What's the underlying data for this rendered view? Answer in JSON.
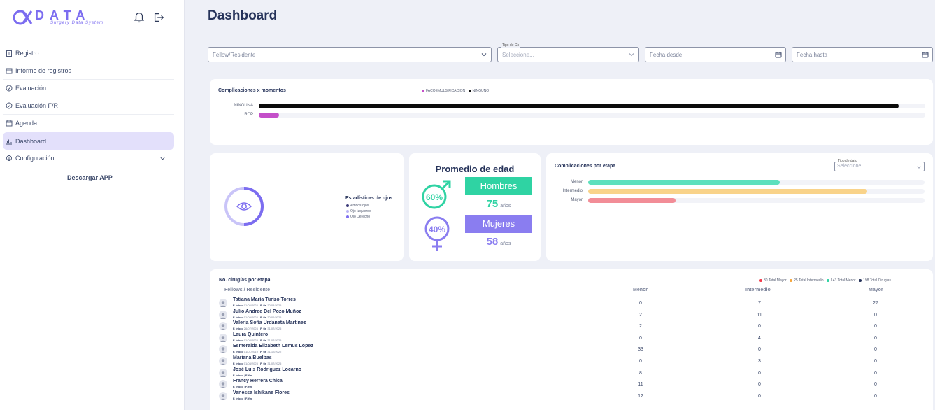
{
  "app": {
    "logo_title": "DATA",
    "logo_subtitle": "Surgery Data System",
    "brand_color": "#7c6df0"
  },
  "sidebar": {
    "items": [
      {
        "label": "Registro",
        "icon": "clipboard-icon"
      },
      {
        "label": "Informe de registros",
        "icon": "calendar-icon"
      },
      {
        "label": "Evaluación",
        "icon": "check-circle-icon"
      },
      {
        "label": "Evaluación F/R",
        "icon": "check-circle-icon"
      },
      {
        "label": "Agenda",
        "icon": "calendar-icon"
      },
      {
        "label": "Dashboard",
        "icon": "bar-chart-icon",
        "active": true
      },
      {
        "label": "Configuración",
        "icon": "gear-icon"
      }
    ],
    "download_label": "Descargar APP"
  },
  "page": {
    "title": "Dashboard"
  },
  "filters": {
    "fellow": "Fellow/Residente",
    "tipo_cx_label": "Tipo de Cx",
    "tipo_cx_placeholder": "Seleccione...",
    "fecha_desde": "Fecha desde",
    "fecha_hasta": "Fecha hasta"
  },
  "complicaciones_momentos": {
    "title": "Complicaciones x momentos",
    "legend": [
      {
        "name": "FACOEMULSIFICACION",
        "color": "#c44fc9"
      },
      {
        "name": "NINGUNO",
        "color": "#111111"
      }
    ],
    "categories": [
      "NINGUNA",
      "RCP"
    ],
    "values": [
      0.96,
      0.03
    ],
    "colors": [
      "#0b0b0b",
      "#c44fc9"
    ]
  },
  "ojos": {
    "title": "Estadísticas de ojos",
    "legend": [
      {
        "name": "Ambos ojos",
        "color": "#3d3c7a"
      },
      {
        "name": "Ojo Izquierdo",
        "color": "#b9b4f5"
      },
      {
        "name": "Ojo Derecho",
        "color": "#7c6df0"
      }
    ]
  },
  "edad": {
    "title": "Promedio de edad",
    "hombres": {
      "label": "Hombres",
      "pct": "60%",
      "age": "75",
      "unit": "años",
      "color": "#2fd3a3"
    },
    "mujeres": {
      "label": "Mujeres",
      "pct": "40%",
      "age": "58",
      "unit": "años",
      "color": "#8a7df0"
    }
  },
  "complicaciones_etapa": {
    "title": "Complicaciones por etapa",
    "select_label": "Tipo de dato",
    "select_placeholder": "Seleccione...",
    "categories": [
      "Menor",
      "Intermedio",
      "Mayor"
    ],
    "values": [
      0.57,
      0.83,
      0.26
    ],
    "colors": [
      "#5ee0bd",
      "#f9d38a",
      "#f28d97"
    ]
  },
  "cirugias": {
    "title": "No. cirugías por etapa",
    "legend": [
      {
        "text": "30 Total Mayor",
        "color": "#f23a4a"
      },
      {
        "text": "25 Total Intermedio",
        "color": "#f5a63c"
      },
      {
        "text": "143 Total Menor",
        "color": "#2fd3a3"
      },
      {
        "text": "198 Total Cirugias",
        "color": "#26335a"
      }
    ],
    "headers": {
      "fellows": "Fellows / Residente",
      "menor": "Menor",
      "intermedio": "Intermedio",
      "mayor": "Mayor"
    },
    "rows": [
      {
        "name": "Tatiana María Turizo Torres",
        "inicio": "01/05/2024",
        "fin": "30/04/2025",
        "menor": "0",
        "intermedio": "7",
        "mayor": "27"
      },
      {
        "name": "Julio Andree Del Pozo Muñoz",
        "inicio": "01/09/2024",
        "fin": "30/06/2025",
        "menor": "2",
        "intermedio": "11",
        "mayor": "0"
      },
      {
        "name": "Valeria Sofía Urdaneta Martínez",
        "inicio": "26/07/2024",
        "fin": "31/07/2025",
        "menor": "2",
        "intermedio": "0",
        "mayor": "0"
      },
      {
        "name": "Laura Quintero",
        "inicio": "01/08/2023",
        "fin": "31/07/2025",
        "menor": "0",
        "intermedio": "4",
        "mayor": "0"
      },
      {
        "name": "Esmeralda Elizabeth Lemus López",
        "inicio": "01/01/2019",
        "fin": "31/12/2022",
        "menor": "33",
        "intermedio": "0",
        "mayor": "0"
      },
      {
        "name": "Mariana Buelbas",
        "inicio": "01/08/2023",
        "fin": "31/07/2025",
        "menor": "0",
        "intermedio": "3",
        "mayor": "0"
      },
      {
        "name": "José Luis Rodríguez Locarno",
        "inicio": "",
        "fin": "",
        "menor": "8",
        "intermedio": "0",
        "mayor": "0"
      },
      {
        "name": "Francy Herrera Chica",
        "inicio": "",
        "fin": "",
        "menor": "11",
        "intermedio": "0",
        "mayor": "0"
      },
      {
        "name": "Vanessa Ishikane Flores",
        "inicio": "",
        "fin": "",
        "menor": "12",
        "intermedio": "0",
        "mayor": "0"
      }
    ]
  }
}
